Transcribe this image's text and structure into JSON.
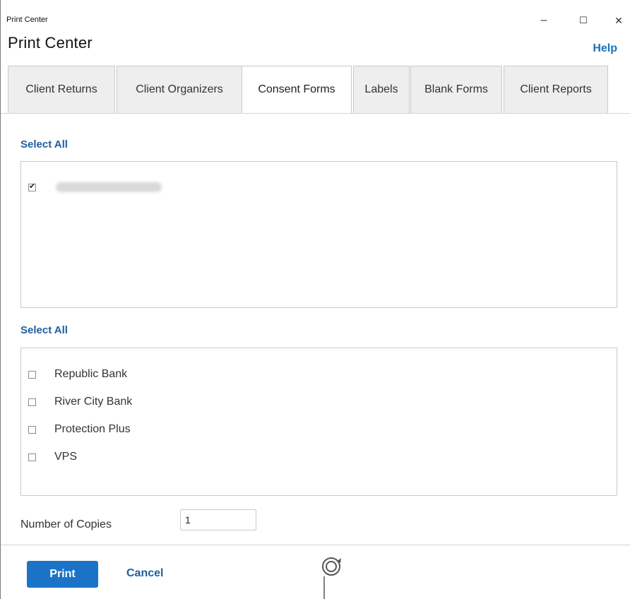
{
  "window": {
    "caption": "Print Center",
    "controls": {
      "minimize": "–",
      "maximize": "☐",
      "close": "✕"
    }
  },
  "header": {
    "title": "Print Center",
    "help": "Help"
  },
  "tabs": [
    {
      "label": "Client Returns",
      "active": false
    },
    {
      "label": "Client Organizers",
      "active": false
    },
    {
      "label": "Consent Forms",
      "active": true
    },
    {
      "label": "Labels",
      "active": false
    },
    {
      "label": "Blank Forms",
      "active": false
    },
    {
      "label": "Client Reports",
      "active": false
    }
  ],
  "clients_section": {
    "select_all": "Select All",
    "items": [
      {
        "label": "",
        "checked": true,
        "obscured": true
      }
    ]
  },
  "banks_section": {
    "select_all": "Select All",
    "items": [
      {
        "label": "Republic Bank",
        "checked": false
      },
      {
        "label": "River City Bank",
        "checked": false
      },
      {
        "label": "Protection Plus",
        "checked": false
      },
      {
        "label": "VPS",
        "checked": false
      }
    ]
  },
  "copies": {
    "label": "Number of Copies",
    "value": "1"
  },
  "footer": {
    "print": "Print",
    "cancel": "Cancel"
  },
  "colors": {
    "accent": "#1a73c7",
    "link": "#1f5f9e",
    "border": "#c9c9c9"
  },
  "icons": {
    "busy": "loading-cursor-icon",
    "checkbox": "checkbox-icon"
  }
}
